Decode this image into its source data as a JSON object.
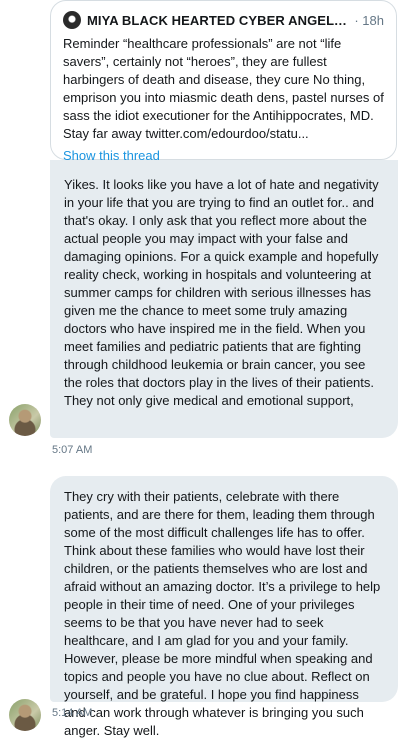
{
  "shared_tweet": {
    "author": "MIYA BLACK HEARTED CYBER ANGEL B...",
    "time": "· 18h",
    "text": "Reminder “healthcare professionals” are not “life savers”, certainly not “heroes”, they are fullest harbingers of death and disease, they cure No thing, emprison you into miasmic death dens, pastel nurses of sass the idiot executioner for the Antihippocrates, MD. Stay far away twitter.com/edourdoo/statu...",
    "show_thread": "Show this thread"
  },
  "messages": [
    {
      "text": "Yikes. It looks like you have a lot of hate and negativity in your life that you are trying to find an outlet for.. and that's okay. I only ask that you reflect more about the actual people you may impact with your false and damaging opinions. For a quick example and hopefully reality check, working in hospitals and volunteering at summer camps for children with serious illnesses has given me the chance to meet some truly amazing doctors who have inspired me in the field. When you meet families and pediatric patients that are fighting through childhood leukemia or brain cancer, you see the roles that doctors play in the lives of their patients. They not only give medical and emotional support,",
      "timestamp": "5:07 AM"
    },
    {
      "text": "They cry with their patients, celebrate with there patients, and are there for them, leading them through some of the most difficult challenges life has to offer. Think about these families who would have lost their children, or the patients themselves who are lost and afraid without an amazing doctor. It’s a privilege to help people in their time of need. One of your privileges seems to be that you have never had to seek healthcare, and I am glad for you and your family. However, please be more mindful when speaking and topics and people you have no clue about. Reflect on yourself, and be grateful. I hope you find happiness and can work through whatever is bringing you such anger. Stay well.",
      "timestamp": "5:14 AM"
    }
  ]
}
